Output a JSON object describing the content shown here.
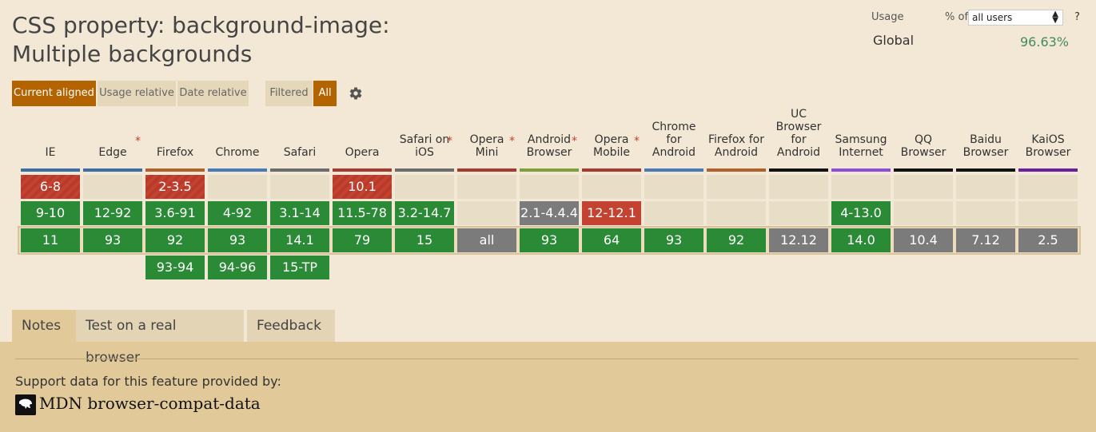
{
  "title": "CSS property: background-image: Multiple backgrounds",
  "usage": {
    "label": "Usage",
    "pct_of": "% of",
    "users_select": "all users",
    "help": "?",
    "global_label": "Global",
    "global_value": "96.63%"
  },
  "toolbar": {
    "current_aligned": "Current aligned",
    "usage_relative": "Usage relative",
    "date_relative": "Date relative",
    "filtered": "Filtered",
    "all": "All"
  },
  "browsers": [
    {
      "name": "IE",
      "star": false,
      "color": "#3b6ea5",
      "rows": [
        {
          "v": "6-8",
          "s": "redstripe"
        },
        {
          "v": "9-10",
          "s": "green"
        },
        {
          "v": "11",
          "s": "green"
        },
        {
          "v": "",
          "s": "none"
        }
      ]
    },
    {
      "name": "Edge",
      "star": true,
      "color": "#3b6ea5",
      "rows": [
        {
          "v": "",
          "s": "empty"
        },
        {
          "v": "12-92",
          "s": "green"
        },
        {
          "v": "93",
          "s": "green"
        },
        {
          "v": "",
          "s": "none"
        }
      ]
    },
    {
      "name": "Firefox",
      "star": false,
      "color": "#b0602a",
      "rows": [
        {
          "v": "2-3.5",
          "s": "redstripe"
        },
        {
          "v": "3.6-91",
          "s": "green"
        },
        {
          "v": "92",
          "s": "green"
        },
        {
          "v": "93-94",
          "s": "green"
        }
      ]
    },
    {
      "name": "Chrome",
      "star": false,
      "color": "#4a7ab5",
      "rows": [
        {
          "v": "",
          "s": "empty"
        },
        {
          "v": "4-92",
          "s": "green"
        },
        {
          "v": "93",
          "s": "green"
        },
        {
          "v": "94-96",
          "s": "green"
        }
      ]
    },
    {
      "name": "Safari",
      "star": false,
      "color": "#6c6c6c",
      "rows": [
        {
          "v": "",
          "s": "empty"
        },
        {
          "v": "3.1-14",
          "s": "green"
        },
        {
          "v": "14.1",
          "s": "green"
        },
        {
          "v": "15-TP",
          "s": "green"
        }
      ]
    },
    {
      "name": "Opera",
      "star": false,
      "color": "#a33a2f",
      "rows": [
        {
          "v": "10.1",
          "s": "redstripe"
        },
        {
          "v": "11.5-78",
          "s": "green"
        },
        {
          "v": "79",
          "s": "green"
        },
        {
          "v": "",
          "s": "none"
        }
      ]
    },
    {
      "name": "Safari on iOS",
      "star": true,
      "color": "#6c6c6c",
      "rows": [
        {
          "v": "",
          "s": "empty"
        },
        {
          "v": "3.2-14.7",
          "s": "green"
        },
        {
          "v": "15",
          "s": "green"
        },
        {
          "v": "",
          "s": "none"
        }
      ]
    },
    {
      "name": "Opera Mini",
      "star": true,
      "color": "#a33a2f",
      "rows": [
        {
          "v": "",
          "s": "empty"
        },
        {
          "v": "",
          "s": "empty"
        },
        {
          "v": "all",
          "s": "gray"
        },
        {
          "v": "",
          "s": "none"
        }
      ]
    },
    {
      "name": "Android Browser",
      "star": true,
      "color": "#7ba03c",
      "rows": [
        {
          "v": "",
          "s": "empty"
        },
        {
          "v": "2.1-4.4.4",
          "s": "gray"
        },
        {
          "v": "93",
          "s": "green"
        },
        {
          "v": "",
          "s": "none"
        }
      ]
    },
    {
      "name": "Opera Mobile",
      "star": true,
      "color": "#a33a2f",
      "rows": [
        {
          "v": "",
          "s": "empty"
        },
        {
          "v": "12-12.1",
          "s": "red"
        },
        {
          "v": "64",
          "s": "green"
        },
        {
          "v": "",
          "s": "none"
        }
      ]
    },
    {
      "name": "Chrome for Android",
      "star": false,
      "color": "#4a7ab5",
      "rows": [
        {
          "v": "",
          "s": "empty"
        },
        {
          "v": "",
          "s": "empty"
        },
        {
          "v": "93",
          "s": "green"
        },
        {
          "v": "",
          "s": "none"
        }
      ]
    },
    {
      "name": "Firefox for Android",
      "star": false,
      "color": "#b0602a",
      "rows": [
        {
          "v": "",
          "s": "empty"
        },
        {
          "v": "",
          "s": "empty"
        },
        {
          "v": "92",
          "s": "green"
        },
        {
          "v": "",
          "s": "none"
        }
      ]
    },
    {
      "name": "UC Browser for Android",
      "star": false,
      "color": "#111111",
      "rows": [
        {
          "v": "",
          "s": "empty"
        },
        {
          "v": "",
          "s": "empty"
        },
        {
          "v": "12.12",
          "s": "gray"
        },
        {
          "v": "",
          "s": "none"
        }
      ]
    },
    {
      "name": "Samsung Internet",
      "star": false,
      "color": "#8a4fd6",
      "rows": [
        {
          "v": "",
          "s": "empty"
        },
        {
          "v": "4-13.0",
          "s": "green"
        },
        {
          "v": "14.0",
          "s": "green"
        },
        {
          "v": "",
          "s": "none"
        }
      ]
    },
    {
      "name": "QQ Browser",
      "star": false,
      "color": "#111111",
      "rows": [
        {
          "v": "",
          "s": "empty"
        },
        {
          "v": "",
          "s": "empty"
        },
        {
          "v": "10.4",
          "s": "gray"
        },
        {
          "v": "",
          "s": "none"
        }
      ]
    },
    {
      "name": "Baidu Browser",
      "star": false,
      "color": "#111111",
      "rows": [
        {
          "v": "",
          "s": "empty"
        },
        {
          "v": "",
          "s": "empty"
        },
        {
          "v": "7.12",
          "s": "gray"
        },
        {
          "v": "",
          "s": "none"
        }
      ]
    },
    {
      "name": "KaiOS Browser",
      "star": false,
      "color": "#6a1fa3",
      "rows": [
        {
          "v": "",
          "s": "empty"
        },
        {
          "v": "",
          "s": "empty"
        },
        {
          "v": "2.5",
          "s": "gray"
        },
        {
          "v": "",
          "s": "none"
        }
      ]
    }
  ],
  "tabs": {
    "notes": "Notes",
    "test": "Test on a real browser",
    "feedback": "Feedback"
  },
  "footer": {
    "provided_by": "Support data for this feature provided by:",
    "mdn_link": "MDN browser-compat-data"
  }
}
